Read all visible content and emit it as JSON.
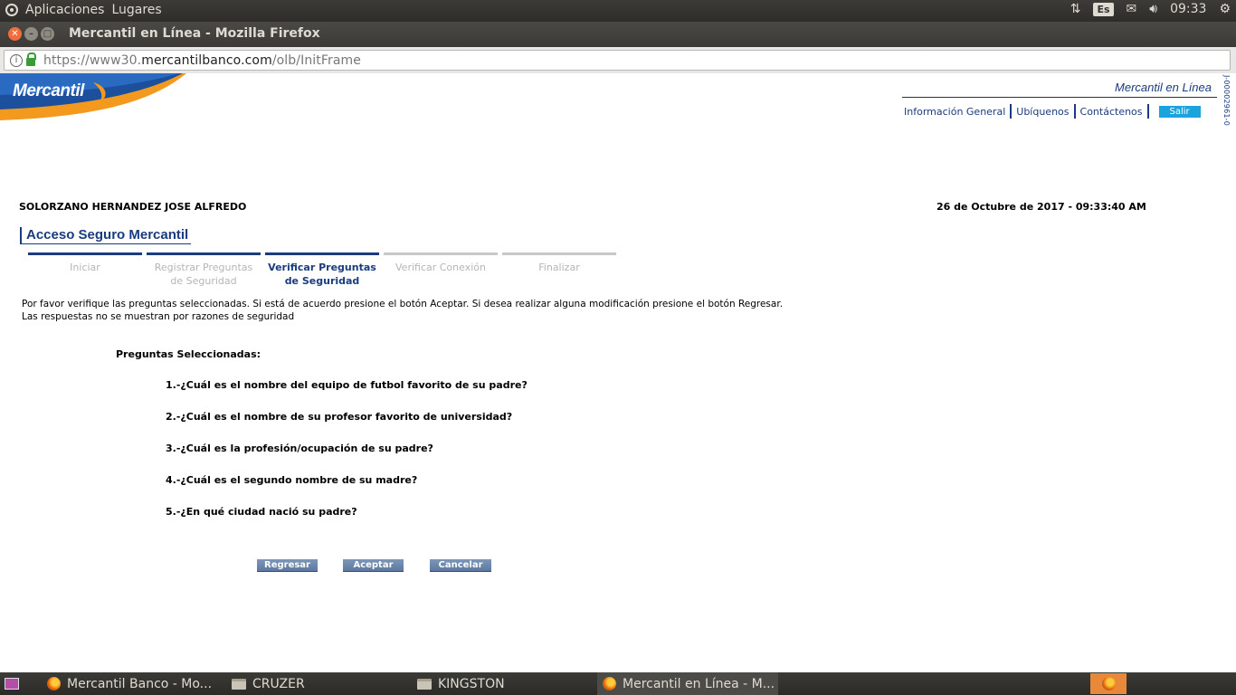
{
  "top_panel": {
    "menus": [
      "Aplicaciones",
      "Lugares"
    ],
    "keyboard_layout": "Es",
    "clock": "09:33"
  },
  "window": {
    "title": "Mercantil en Línea - Mozilla Firefox"
  },
  "address_bar": {
    "url_prefix": "https://www30.",
    "url_domain": "mercantilbanco.com",
    "url_path": "/olb/InitFrame"
  },
  "site": {
    "logo_text": "Mercantil",
    "brand": "Mercantil en Línea",
    "links": [
      "Información General",
      "Ubíquenos",
      "Contáctenos"
    ],
    "logout_label": "Salir",
    "side_code": "J-00002961-0"
  },
  "session": {
    "user_name": "SOLORZANO HERNANDEZ JOSE ALFREDO",
    "date_time": "26 de Octubre de 2017 - 09:33:40 AM"
  },
  "wizard": {
    "title": "Acceso Seguro Mercantil",
    "steps": [
      {
        "line1": "Iniciar",
        "line2": ""
      },
      {
        "line1": "Registrar Preguntas",
        "line2": "de Seguridad"
      },
      {
        "line1": "Verificar Preguntas",
        "line2": "de Seguridad"
      },
      {
        "line1": "Verificar Conexión",
        "line2": ""
      },
      {
        "line1": "Finalizar",
        "line2": ""
      }
    ],
    "active_step": 3,
    "instructions_line1": "Por favor verifique las preguntas seleccionadas. Si está de acuerdo presione el botón Aceptar. Si desea realizar alguna modificación presione el botón Regresar.",
    "instructions_line2": "Las respuestas no se muestran por razones de seguridad",
    "questions_heading": "Preguntas Seleccionadas:",
    "questions": [
      "1.-¿Cuál es el nombre del equipo de futbol favorito de su padre?",
      "2.-¿Cuál es el nombre de su profesor favorito de universidad?",
      "3.-¿Cuál es la profesión/ocupación de su padre?",
      "4.-¿Cuál es el segundo nombre de su madre?",
      "5.-¿En qué ciudad nació su padre?"
    ],
    "buttons": {
      "back": "Regresar",
      "accept": "Aceptar",
      "cancel": "Cancelar"
    }
  },
  "taskbar": {
    "items": [
      "Mercantil Banco - Mo...",
      "CRUZER",
      "KINGSTON",
      "Mercantil en Línea - M..."
    ]
  },
  "colors": {
    "brand_blue": "#1a3b7e",
    "salir_button": "#1aa3dc",
    "action_button": "#6a84aa",
    "logo_orange": "#f39a1e"
  }
}
